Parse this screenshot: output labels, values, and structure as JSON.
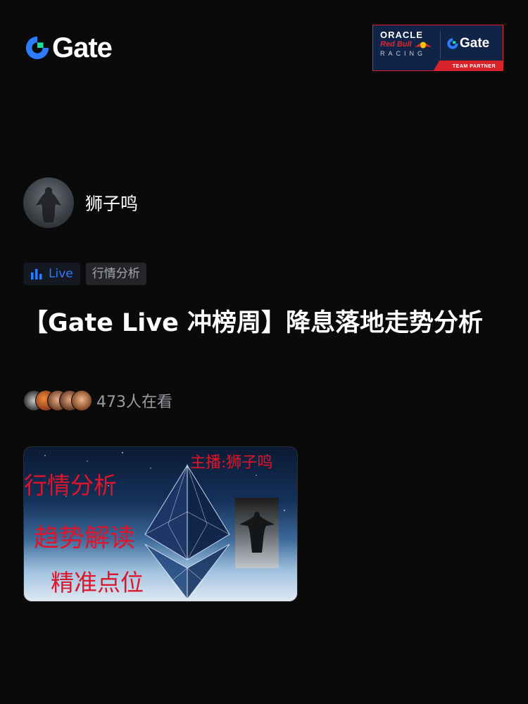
{
  "brand": {
    "name": "Gate",
    "accent": "#2e7bff",
    "logo_green": "#17e3a0"
  },
  "partner_banner": {
    "line1": "ORACLE",
    "line2": "Red Bull",
    "line3": "RACING",
    "gate": "Gate",
    "badge": "TEAM PARTNER"
  },
  "host": {
    "name": "狮子鸣",
    "avatar_icon": "avatar-image"
  },
  "tags": {
    "live_label": "Live",
    "category": "行情分析"
  },
  "stream": {
    "title": "【Gate Live 冲榜周】降息落地走势分析",
    "viewer_count": "473人在看"
  },
  "cover": {
    "line1": "行情分析",
    "line2": "趋势解读",
    "line3": "精准点位",
    "host_label": "主播:狮子鸣",
    "icon": "ethereum-icon"
  }
}
